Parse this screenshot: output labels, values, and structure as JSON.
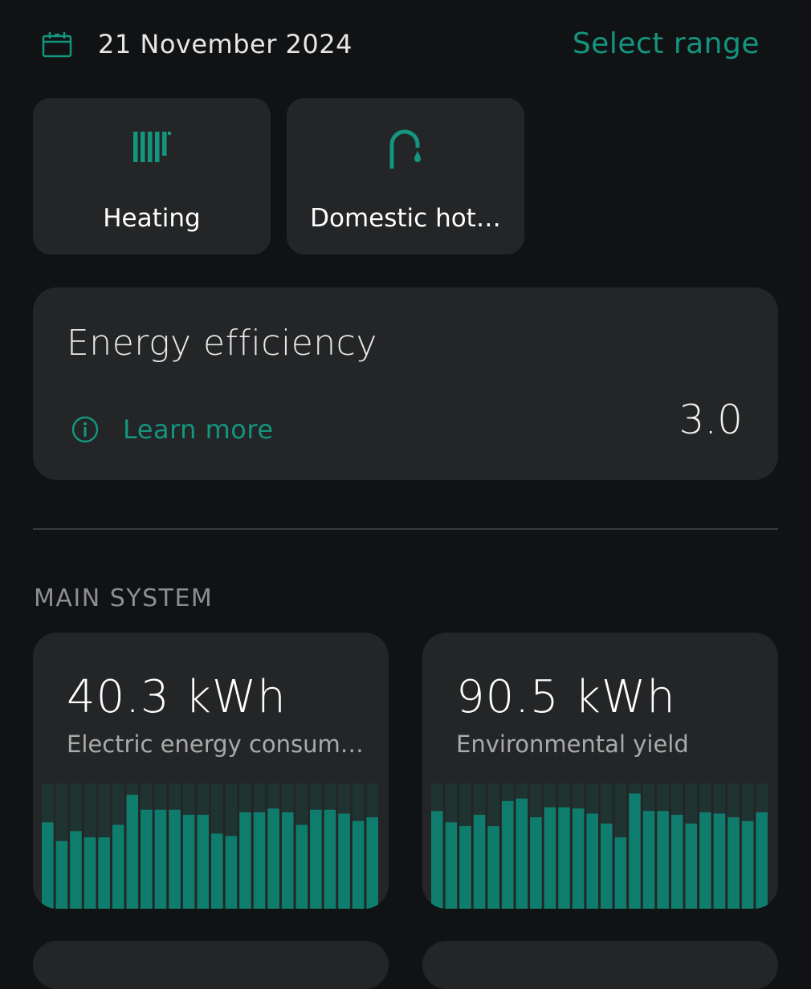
{
  "header": {
    "date": "21 November 2024",
    "select_range_label": "Select range",
    "calendar_icon": "calendar-icon"
  },
  "tiles": [
    {
      "label": "Heating",
      "icon": "radiator-icon"
    },
    {
      "label": "Domestic hot…",
      "icon": "tap-icon"
    }
  ],
  "efficiency": {
    "title": "Energy efficiency",
    "learn_more_label": "Learn more",
    "info_icon": "info-icon",
    "value": "3.0"
  },
  "main_system": {
    "section_title": "MAIN SYSTEM",
    "cards": [
      {
        "value": "40.3 kWh",
        "label": "Electric energy consum…"
      },
      {
        "value": "90.5 kWh",
        "label": "Environmental yield"
      }
    ]
  },
  "colors": {
    "accent": "#13957f",
    "bar_active": "#0f7d6d",
    "bar_track": "#1f3431",
    "card_bg": "#242526",
    "page_bg": "#111213"
  },
  "chart_data": [
    {
      "type": "bar",
      "values": [
        0.69,
        0.54,
        0.62,
        0.57,
        0.57,
        0.67,
        0.91,
        0.79,
        0.79,
        0.79,
        0.75,
        0.75,
        0.6,
        0.58,
        0.77,
        0.77,
        0.8,
        0.77,
        0.67,
        0.79,
        0.79,
        0.76,
        0.7,
        0.73
      ],
      "ylim": [
        0,
        1
      ],
      "grid": false
    },
    {
      "type": "bar",
      "values": [
        0.78,
        0.69,
        0.66,
        0.75,
        0.66,
        0.86,
        0.88,
        0.73,
        0.81,
        0.81,
        0.8,
        0.76,
        0.68,
        0.57,
        0.92,
        0.78,
        0.78,
        0.75,
        0.68,
        0.77,
        0.76,
        0.73,
        0.7,
        0.77
      ],
      "ylim": [
        0,
        1
      ],
      "grid": false
    }
  ]
}
